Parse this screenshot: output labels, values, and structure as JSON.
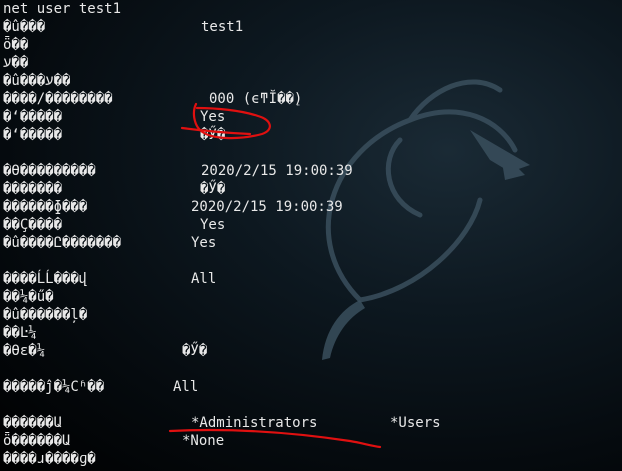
{
  "terminal": {
    "command": "net user test1",
    "rows": [
      {
        "label": "�û���",
        "value": "test1"
      },
      {
        "label": "ȫ��",
        "value": ""
      },
      {
        "label": "ע��",
        "value": ""
      },
      {
        "label": "�û���ע��",
        "value": ""
      },
      {
        "label": "����/��������",
        "value": "000 (ϵͳĬ��ֵ)"
      },
      {
        "label": "�ʻ�����",
        "value": "Yes"
      },
      {
        "label": "�ʻ�����",
        "value": "�Ӳ�"
      },
      {
        "label": "�ϴ���������",
        "value": "2020/2/15 19:00:39"
      },
      {
        "label": "�������",
        "value": "�Ӳ�"
      },
      {
        "label": "������ɸ���",
        "value": "2020/2/15 19:00:39"
      },
      {
        "label": "��Ҫ����",
        "value": "Yes"
      },
      {
        "label": "�û����Ը�������",
        "value": "Yes"
      },
      {
        "label": "����ĹĹ���վ",
        "value": "All"
      },
      {
        "label": "��¼�ű�",
        "value": ""
      },
      {
        "label": "�û������ļ�",
        "value": ""
      },
      {
        "label": "��Ŀ¼",
        "value": ""
      },
      {
        "label": "�ϴε�¼",
        "value": "�Ӳ�"
      },
      {
        "label": "�����ĵ�¼Сʱ��",
        "value": "All"
      },
      {
        "label": "������Ա",
        "value": "*Administrators",
        "value2": "*Users"
      },
      {
        "label": "ȫ������Ա",
        "value": "*None"
      },
      {
        "label": "����ɹ����ɡ�",
        "value": ""
      }
    ]
  },
  "annotation": {
    "color": "#e01010"
  },
  "wallpaper": {
    "color": "#3a4f5d"
  }
}
